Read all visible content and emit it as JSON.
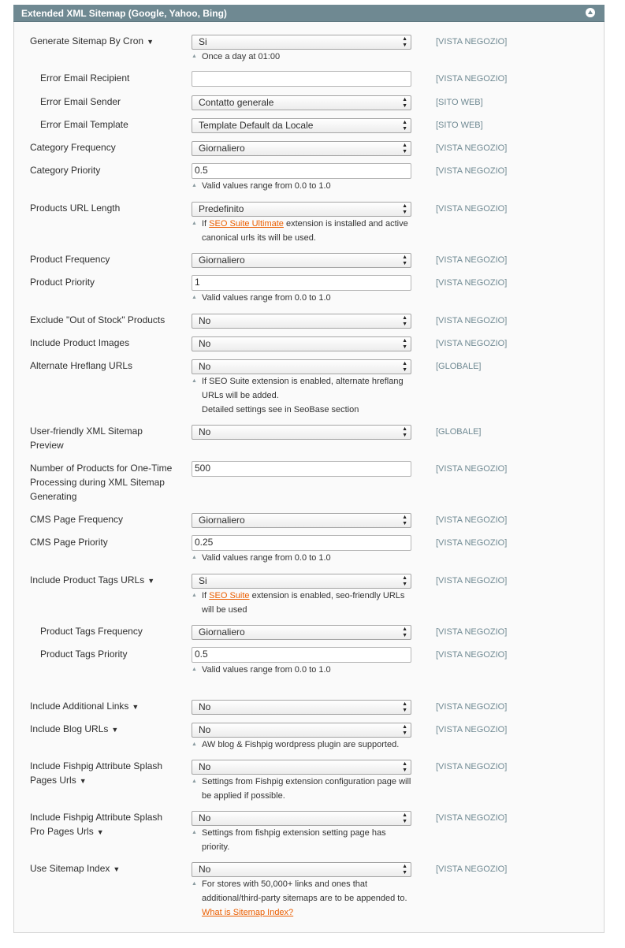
{
  "section": {
    "title": "Extended XML Sitemap (Google, Yahoo, Bing)"
  },
  "rows": [
    {
      "id": "generate-sitemap-by-cron",
      "label": "Generate Sitemap By Cron",
      "caret": true,
      "type": "select",
      "value": "Si",
      "scope": "[VISTA NEGOZIO]",
      "note": {
        "text": "Once a day at 01:00"
      }
    },
    {
      "id": "error-email-recipient",
      "label": "Error Email Recipient",
      "type": "text",
      "value": "",
      "scope": "[VISTA NEGOZIO]"
    },
    {
      "id": "error-email-sender",
      "label": "Error Email Sender",
      "type": "select",
      "value": "Contatto generale",
      "scope": "[SITO WEB]"
    },
    {
      "id": "error-email-template",
      "label": "Error Email Template",
      "type": "select",
      "value": "Template Default da Locale",
      "scope": "[SITO WEB]"
    },
    {
      "id": "category-frequency",
      "label": "Category Frequency",
      "type": "select",
      "value": "Giornaliero",
      "scope": "[VISTA NEGOZIO]"
    },
    {
      "id": "category-priority",
      "label": "Category Priority",
      "type": "text",
      "value": "0.5",
      "scope": "[VISTA NEGOZIO]",
      "note": {
        "text": "Valid values range from 0.0 to 1.0"
      }
    },
    {
      "id": "products-url-length",
      "label": "Products URL Length",
      "type": "select",
      "value": "Predefinito",
      "scope": "[VISTA NEGOZIO]",
      "note": {
        "before": "If ",
        "link": "SEO Suite Ultimate",
        "after": " extension is installed and active",
        "line2": "canonical urls its will be used."
      }
    },
    {
      "id": "product-frequency",
      "label": "Product Frequency",
      "type": "select",
      "value": "Giornaliero",
      "scope": "[VISTA NEGOZIO]"
    },
    {
      "id": "product-priority",
      "label": "Product Priority",
      "type": "text",
      "value": "1",
      "scope": "[VISTA NEGOZIO]",
      "note": {
        "text": "Valid values range from 0.0 to 1.0"
      }
    },
    {
      "id": "exclude-out-of-stock",
      "label": "Exclude \"Out of Stock\" Products",
      "type": "select",
      "value": "No",
      "scope": "[VISTA NEGOZIO]"
    },
    {
      "id": "include-product-images",
      "label": "Include Product Images",
      "type": "select",
      "value": "No",
      "scope": "[VISTA NEGOZIO]"
    },
    {
      "id": "alternate-hreflang-urls",
      "label": "Alternate Hreflang URLs",
      "type": "select",
      "value": "No",
      "scope": "[GLOBALE]",
      "note": {
        "text": "If SEO Suite extension is enabled, alternate hreflang",
        "line2": "URLs will be added.",
        "line3": "Detailed settings see in SeoBase section"
      }
    },
    {
      "id": "user-friendly-xml-sitemap-preview",
      "label": "User-friendly XML Sitemap",
      "label2": "Preview",
      "type": "select",
      "value": "No",
      "scope": "[GLOBALE]"
    },
    {
      "id": "number-of-products-one-time",
      "label": "Number of Products for One-Time",
      "label2": "Processing during XML Sitemap",
      "label3": "Generating",
      "type": "text",
      "value": "500",
      "scope": "[VISTA NEGOZIO]"
    },
    {
      "id": "cms-page-frequency",
      "label": "CMS Page Frequency",
      "type": "select",
      "value": "Giornaliero",
      "scope": "[VISTA NEGOZIO]"
    },
    {
      "id": "cms-page-priority",
      "label": "CMS Page Priority",
      "type": "text",
      "value": "0.25",
      "scope": "[VISTA NEGOZIO]",
      "note": {
        "text": "Valid values range from 0.0 to 1.0"
      }
    },
    {
      "id": "include-product-tags-urls",
      "label": "Include Product Tags URLs",
      "caret": true,
      "type": "select",
      "value": "Si",
      "scope": "[VISTA NEGOZIO]",
      "note": {
        "before": "If ",
        "link": "SEO Suite",
        "after": " extension is enabled, seo-friendly URLs",
        "line2": "will be used"
      }
    },
    {
      "id": "product-tags-frequency",
      "label": "Product Tags Frequency",
      "type": "select",
      "value": "Giornaliero",
      "scope": "[VISTA NEGOZIO]"
    },
    {
      "id": "product-tags-priority",
      "label": "Product Tags Priority",
      "type": "text",
      "value": "0.5",
      "scope": "[VISTA NEGOZIO]",
      "note": {
        "text": "Valid values range from 0.0 to 1.0"
      }
    },
    {
      "id": "include-additional-links",
      "label": "Include Additional Links",
      "caret": true,
      "type": "select",
      "value": "No",
      "scope": "[VISTA NEGOZIO]"
    },
    {
      "id": "include-blog-urls",
      "label": "Include Blog URLs",
      "caret": true,
      "type": "select",
      "value": "No",
      "scope": "[VISTA NEGOZIO]",
      "note": {
        "text": "AW blog & Fishpig wordpress plugin are supported."
      }
    },
    {
      "id": "include-fishpig-splash",
      "label": "Include Fishpig Attribute Splash",
      "label2": "Pages Urls",
      "caret": true,
      "type": "select",
      "value": "No",
      "scope": "[VISTA NEGOZIO]",
      "note": {
        "text": "Settings from Fishpig extension configuration page will",
        "line2": "be applied if possible."
      }
    },
    {
      "id": "include-fishpig-splash-pro",
      "label": "Include Fishpig Attribute Splash",
      "label2": "Pro Pages Urls",
      "caret": true,
      "type": "select",
      "value": "No",
      "scope": "[VISTA NEGOZIO]",
      "note": {
        "text": "Settings from fishpig extension setting page has",
        "line2": "priority."
      }
    },
    {
      "id": "use-sitemap-index",
      "label": "Use Sitemap Index",
      "caret": true,
      "type": "select",
      "value": "No",
      "scope": "[VISTA NEGOZIO]",
      "note": {
        "text": "For stores with 50,000+ links and ones that",
        "line2": "additional/third-party sitemaps are to be appended to.",
        "link3": "What is Sitemap Index?"
      }
    }
  ]
}
